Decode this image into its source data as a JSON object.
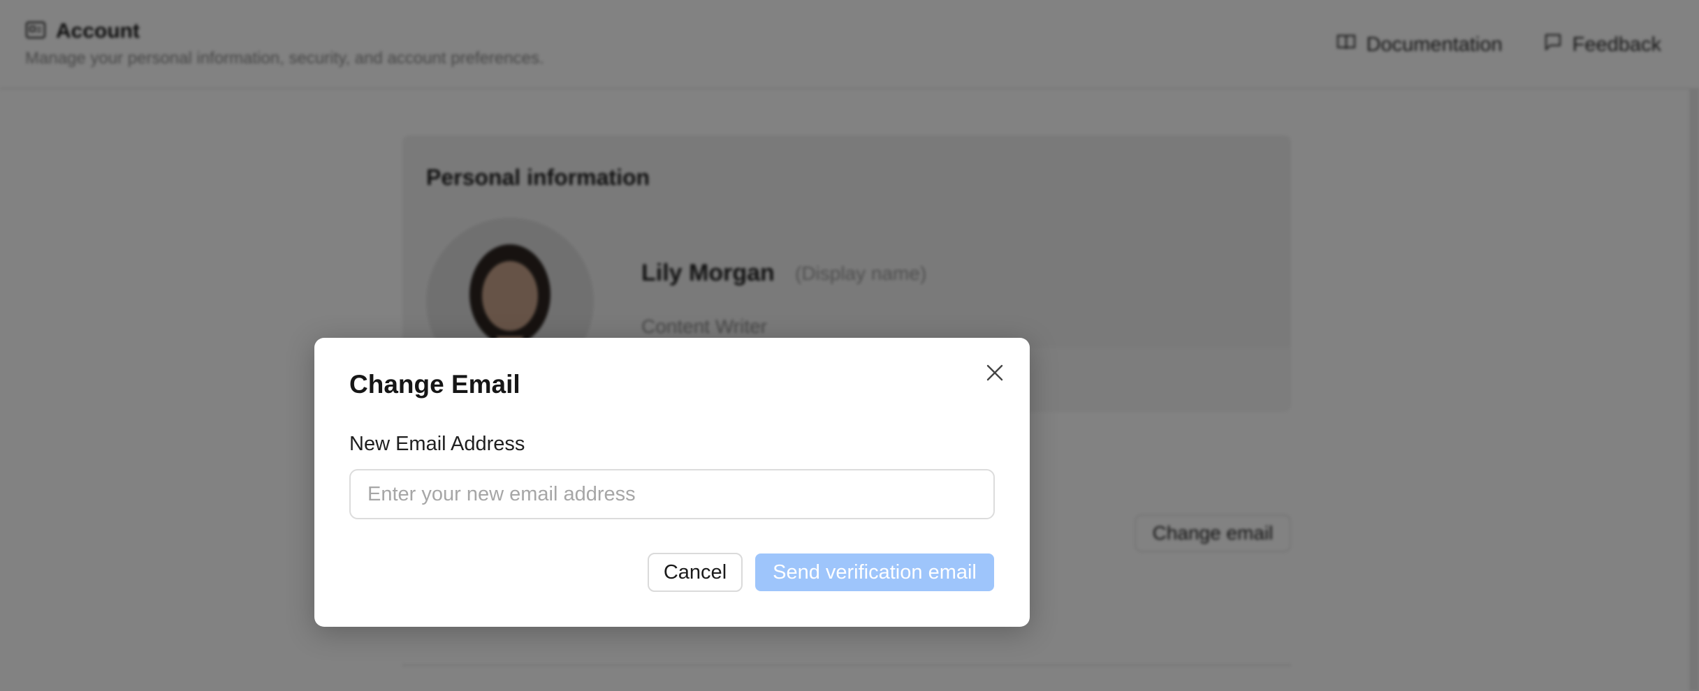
{
  "header": {
    "title": "Account",
    "subtitle": "Manage your personal information, security, and account preferences.",
    "links": [
      {
        "label": "Documentation",
        "icon": "book-icon"
      },
      {
        "label": "Feedback",
        "icon": "message-icon"
      }
    ]
  },
  "profile": {
    "section_title": "Personal information",
    "name": "Lily Morgan",
    "display_hint": "(Display name)",
    "role": "Content Writer",
    "change_email_label": "Change email"
  },
  "dialog": {
    "title": "Change Email",
    "field_label": "New Email Address",
    "input_value": "",
    "input_placeholder": "Enter your new email address",
    "cancel_label": "Cancel",
    "submit_label": "Send verification email",
    "submit_color": "#9ec5fb"
  },
  "colors": {
    "overlay": "rgba(0,0,0,0.49)",
    "accent_disabled": "#9ec5fb"
  }
}
